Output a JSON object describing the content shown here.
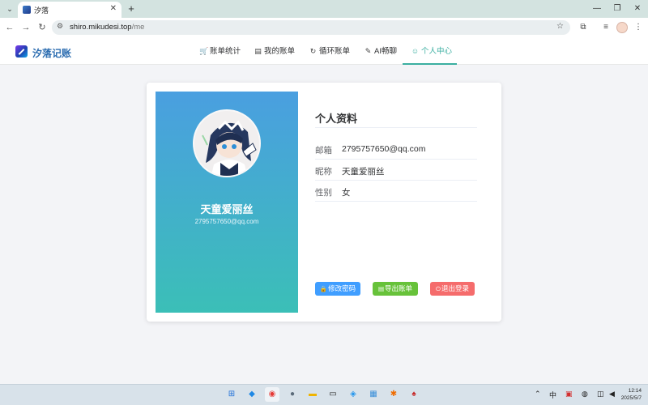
{
  "browser": {
    "tab_title": "汐落",
    "tab_menu_icon": "chevron-down",
    "new_tab_icon": "+",
    "url_host": "shiro.mikudesi.top",
    "url_path": "/me"
  },
  "app": {
    "logo_text": "汐落记账",
    "nav": [
      {
        "label": "账单统计",
        "icon": "cart-icon"
      },
      {
        "label": "我的账单",
        "icon": "document-icon"
      },
      {
        "label": "循环账单",
        "icon": "refresh-icon"
      },
      {
        "label": "AI畅聊",
        "icon": "pen-icon"
      },
      {
        "label": "个人中心",
        "icon": "user-icon",
        "active": true
      }
    ],
    "accent_color": "#3aaea0"
  },
  "profile": {
    "name": "天童爱丽丝",
    "email": "2795757650@qq.com",
    "section_title": "个人资料",
    "fields": [
      {
        "label": "邮箱",
        "value": "2795757650@qq.com"
      },
      {
        "label": "昵称",
        "value": "天童爱丽丝"
      },
      {
        "label": "性别",
        "value": "女"
      }
    ],
    "buttons": [
      {
        "label": "修改密码",
        "color": "#409eff",
        "icon": "lock-icon"
      },
      {
        "label": "导出账单",
        "color": "#67c23a",
        "icon": "document-icon"
      },
      {
        "label": "退出登录",
        "color": "#f56c6c",
        "icon": "power-icon"
      }
    ],
    "gradient": [
      "#4a9fe0",
      "#3bbfb7"
    ]
  },
  "taskbar": {
    "ime": "中",
    "clock_time": "12:14",
    "clock_date": "2025/5/7"
  }
}
